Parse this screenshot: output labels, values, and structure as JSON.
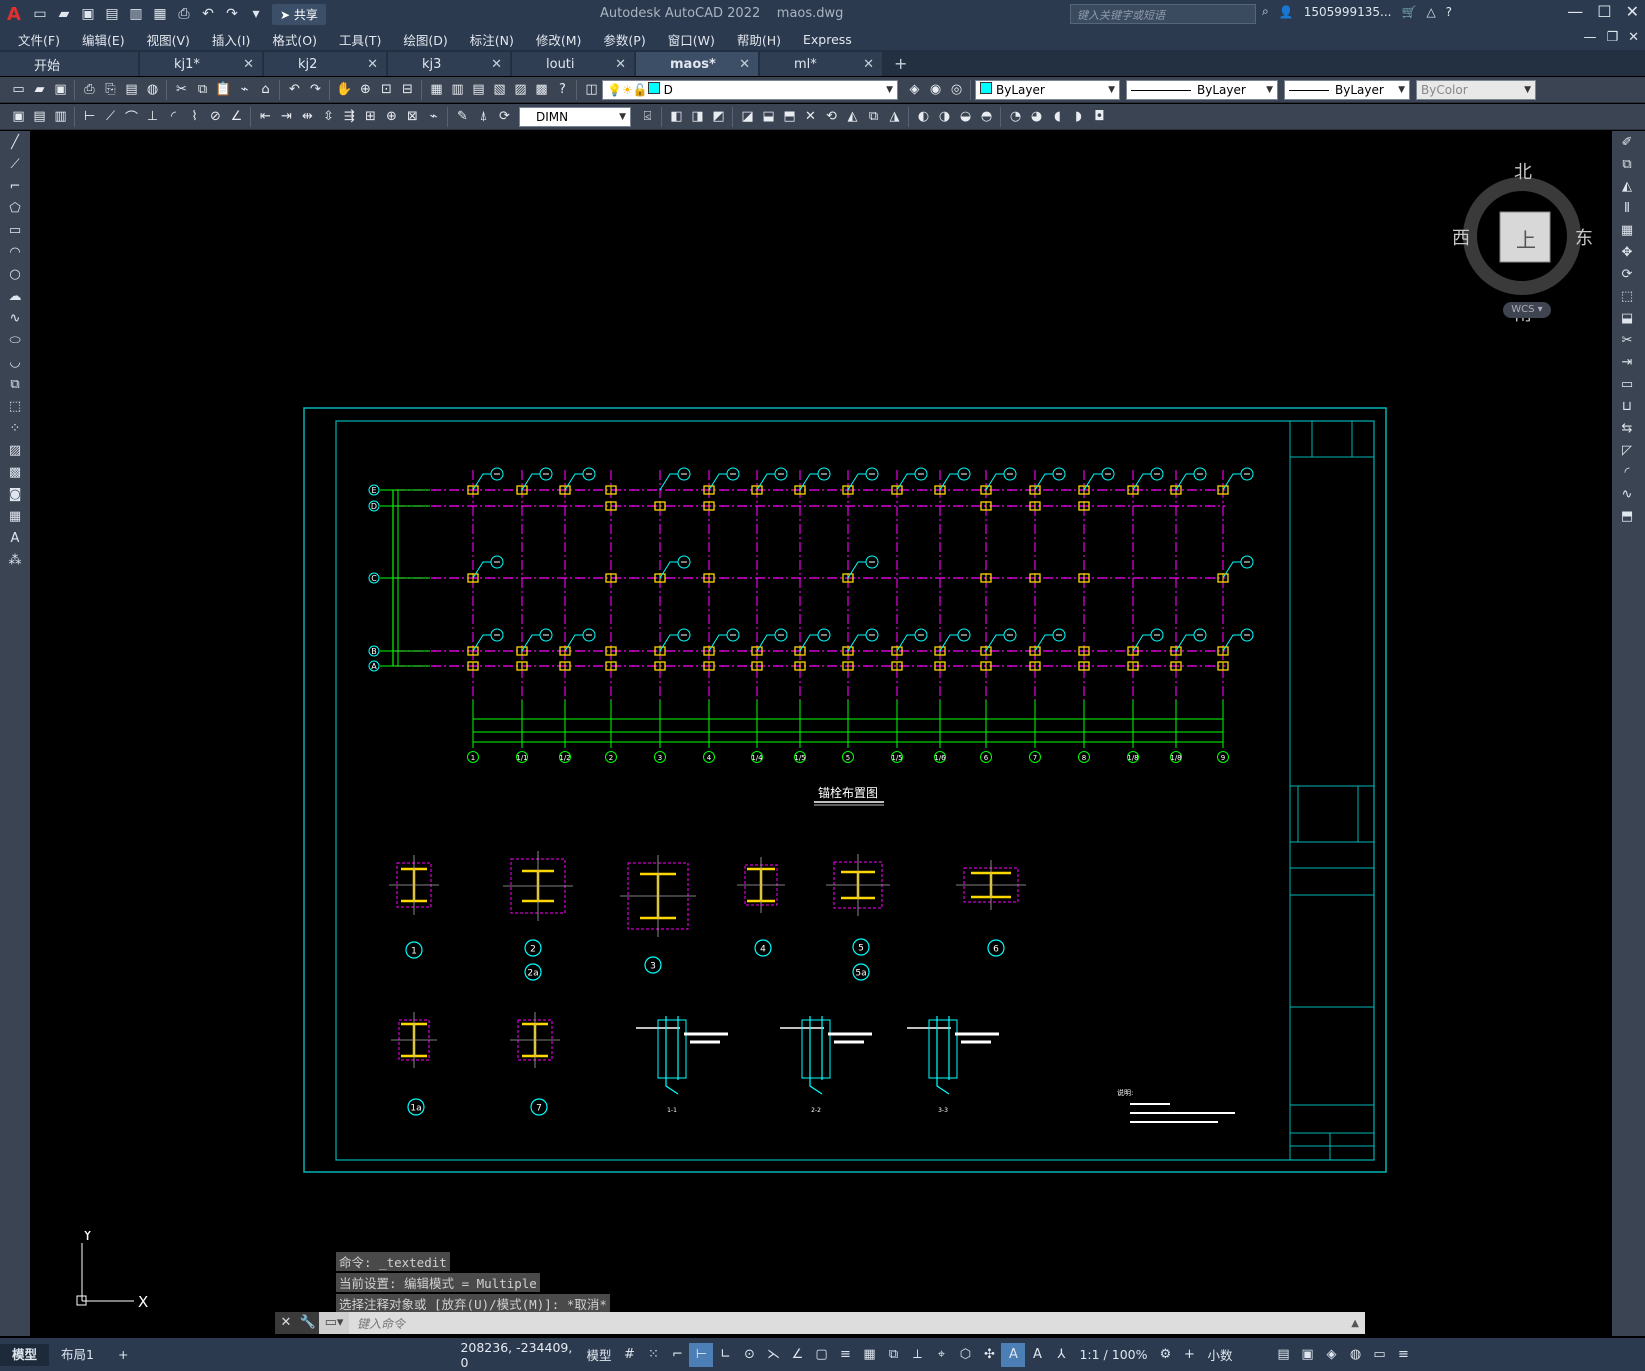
{
  "app": {
    "title": "Autodesk AutoCAD 2022",
    "filename": "maos.dwg",
    "share_label": "共享",
    "search_placeholder": "键入关键字或短语",
    "user": "1505999135...",
    "logo": "A"
  },
  "menu": [
    "文件(F)",
    "编辑(E)",
    "视图(V)",
    "插入(I)",
    "格式(O)",
    "工具(T)",
    "绘图(D)",
    "标注(N)",
    "修改(M)",
    "参数(P)",
    "窗口(W)",
    "帮助(H)",
    "Express"
  ],
  "tabs": [
    {
      "label": "开始",
      "active": false
    },
    {
      "label": "kj1*",
      "active": false
    },
    {
      "label": "kj2",
      "active": false
    },
    {
      "label": "kj3",
      "active": false
    },
    {
      "label": "louti",
      "active": false
    },
    {
      "label": "maos*",
      "active": true
    },
    {
      "label": "ml*",
      "active": false
    }
  ],
  "toolbar": {
    "layer_value": "D",
    "color_value": "ByLayer",
    "linetype_value": "ByLayer",
    "lineweight_value": "ByLayer",
    "plotstyle_value": "ByColor",
    "dimstyle_value": "DIMN"
  },
  "viewcube": {
    "north": "北",
    "south": "南",
    "east": "东",
    "west": "西",
    "face": "上",
    "wcs": "WCS"
  },
  "drawing": {
    "plan_title": "锚栓布置图",
    "rows": [
      "E",
      "D",
      "C",
      "B",
      "A"
    ],
    "columns": [
      "1",
      "1/1",
      "1/2",
      "2",
      "3",
      "4",
      "1/4",
      "1/5",
      "5",
      "1/5",
      "1/6",
      "6",
      "7",
      "8",
      "1/8",
      "1/8",
      "9"
    ],
    "details": [
      "1",
      "2",
      "2a",
      "3",
      "4",
      "5",
      "5a",
      "6",
      "1a",
      "7"
    ],
    "section_labels": [
      "1-1",
      "2-2",
      "3-3"
    ],
    "notes_title": "说明:"
  },
  "command": {
    "history": [
      "命令: _textedit",
      "当前设置: 编辑模式 = Multiple",
      "选择注释对象或 [放弃(U)/模式(M)]: *取消*"
    ],
    "input_placeholder": "键入命令"
  },
  "ucs": {
    "x": "X",
    "y": "Y"
  },
  "status": {
    "model_tab": "模型",
    "layout_tab": "布局1",
    "coords": "208236, -234409, 0",
    "space": "模型",
    "scale": "1:1 / 100%",
    "units": "小数"
  },
  "colors": {
    "titlebar": "#2b3a4f",
    "toolbar": "#3b4453",
    "frame": "#00c0c0",
    "grid_line": "#ff00ff",
    "green_line": "#00ff00",
    "bolt": "#ffd700",
    "bubble": "#00ffff"
  }
}
